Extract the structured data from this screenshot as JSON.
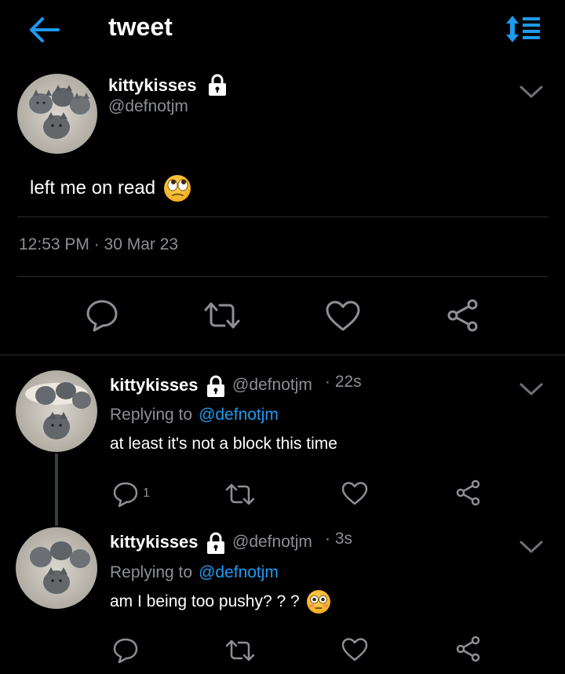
{
  "header": {
    "title": "tweet"
  },
  "tweet": {
    "name": "kittykisses",
    "handle": "@defnotjm",
    "text": "left me on read",
    "timestamp": "12:53 PM · 30 Mar 23"
  },
  "replies": [
    {
      "name": "kittykisses",
      "handle": "@defnotjm",
      "time": "· 22s",
      "replying_prefix": "Replying to",
      "replying_handle": "@defnotjm",
      "text": "at least it's not a block this time",
      "reply_count": "1"
    },
    {
      "name": "kittykisses",
      "handle": "@defnotjm",
      "time": "· 3s",
      "replying_prefix": "Replying to",
      "replying_handle": "@defnotjm",
      "text": "am I being too pushy? ? ?"
    }
  ],
  "colors": {
    "background": "#000000",
    "accent": "#1d9bf0",
    "muted": "#8c8f94"
  },
  "icons": [
    "back-arrow-icon",
    "sort-icon",
    "lock-icon",
    "chevron-down-icon",
    "reply-icon",
    "retweet-icon",
    "like-icon",
    "share-icon",
    "eye-roll-emoji",
    "flushed-emoji"
  ]
}
